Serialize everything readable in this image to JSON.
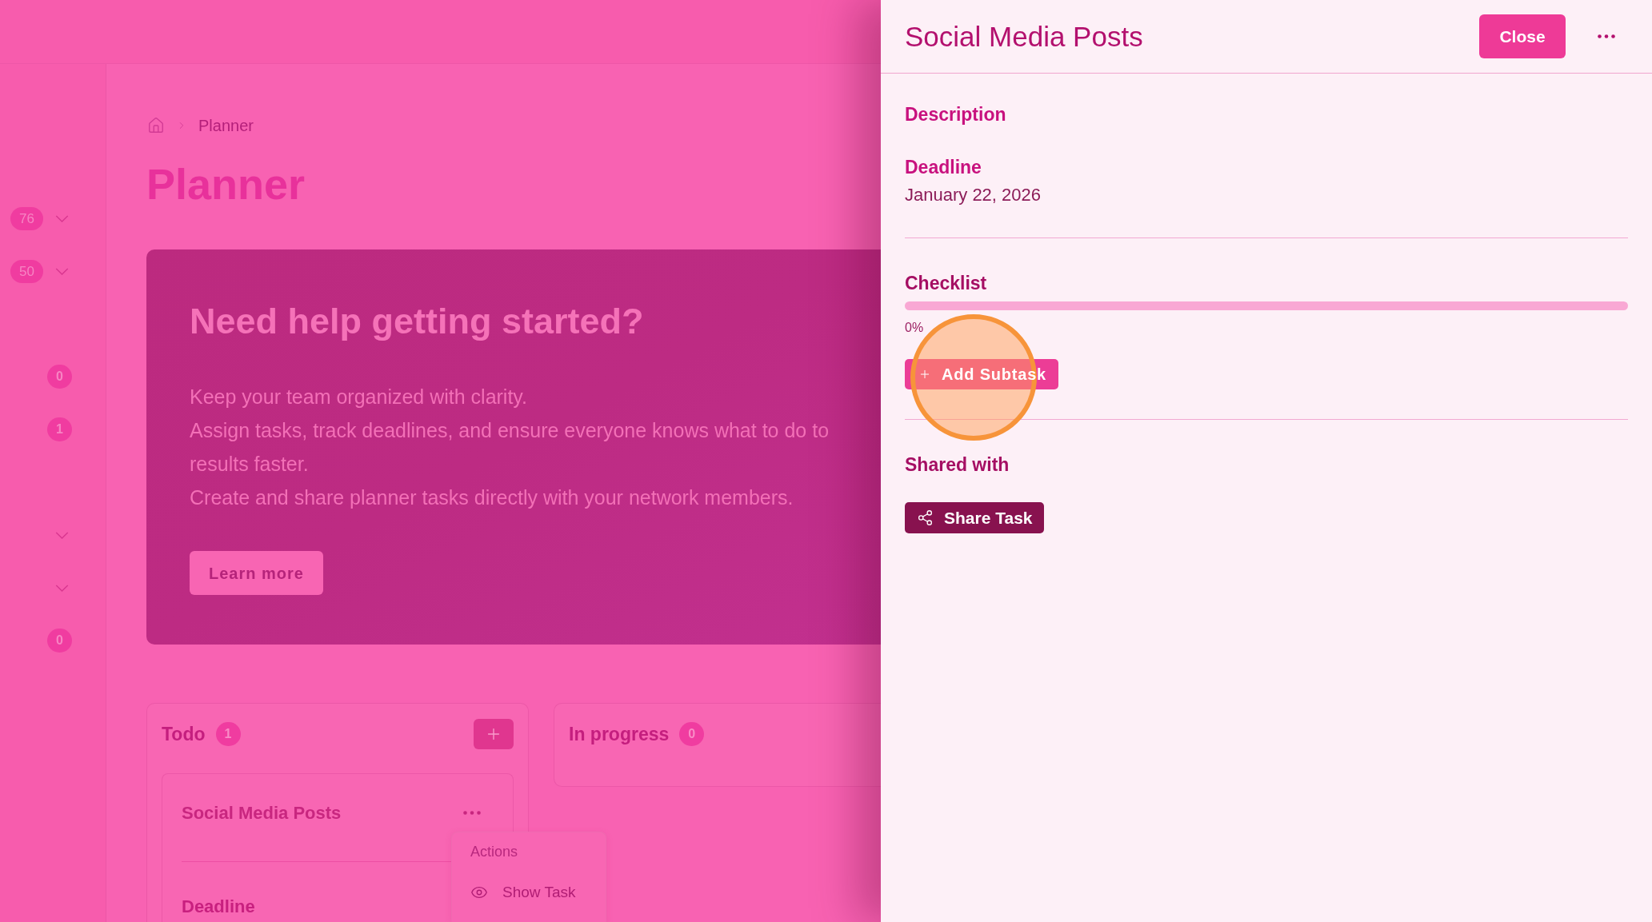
{
  "sidebar": {
    "groups": [
      {
        "items": [
          {
            "kind": "group",
            "badge": "76",
            "expanded": false
          },
          {
            "kind": "group",
            "badge": "50",
            "expanded": false
          }
        ]
      },
      {
        "items": [
          {
            "kind": "link",
            "badge": "0"
          },
          {
            "kind": "link",
            "badge": "1"
          }
        ]
      },
      {
        "items": [
          {
            "kind": "group",
            "expanded": false
          },
          {
            "kind": "group",
            "expanded": false
          },
          {
            "kind": "link",
            "badge": "0"
          }
        ]
      }
    ]
  },
  "breadcrumb": [
    "Planner"
  ],
  "page_title": "Planner",
  "banner": {
    "title": "Need help getting started?",
    "lines": [
      "Keep your team organized with clarity.",
      "Assign tasks, track deadlines, and ensure everyone knows what to do to",
      "results faster.",
      "Create and share planner tasks directly with your network members."
    ],
    "button": "Learn more"
  },
  "board": {
    "columns": [
      {
        "title": "Todo",
        "count": "1",
        "add_button": true,
        "tasks": [
          {
            "title": "Social Media Posts",
            "fields": [
              "Deadline"
            ],
            "menu": {
              "open": true,
              "heading": "Actions",
              "items": [
                "Show Task"
              ]
            }
          }
        ]
      },
      {
        "title": "In progress",
        "count": "0",
        "add_button": false
      }
    ]
  },
  "task_panel": {
    "title": "Social Media Posts",
    "close_button": "Close",
    "sections": [
      {
        "kind": "text",
        "label": "Description"
      },
      {
        "kind": "field",
        "label": "Deadline",
        "value": "January 22, 2026"
      },
      {
        "kind": "checklist",
        "label": "Checklist",
        "level": 0,
        "reading": "0%",
        "button": "Add Subtask"
      },
      {
        "kind": "share",
        "label": "Shared with",
        "button": "Share Task"
      }
    ]
  }
}
